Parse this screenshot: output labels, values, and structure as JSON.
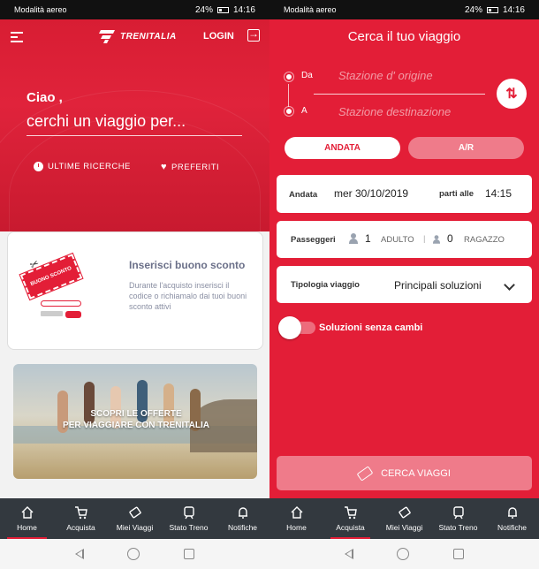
{
  "status_bar": {
    "carrier": "Modalità aereo",
    "battery": "24%",
    "time": "14:16"
  },
  "left": {
    "header": {
      "logo_text": "TRENITALIA",
      "login_label": "LOGIN"
    },
    "greeting": {
      "title": "Ciao ,",
      "subtitle": "cerchi un viaggio per..."
    },
    "quick_links": {
      "recent": "ULTIME RICERCHE",
      "favorites": "PREFERITI"
    },
    "coupon": {
      "ticket_text": "BUONO SCONTO",
      "title": "Inserisci buono sconto",
      "description": "Durante l'acquisto inserisci il codice o richiamalo dai tuoi buoni sconto attivi"
    },
    "promo": {
      "line1": "SCOPRI LE OFFERTE",
      "line2": "PER VIAGGIARE CON TRENITALIA"
    }
  },
  "right": {
    "title": "Cerca il tuo viaggio",
    "from_label": "Da",
    "from_placeholder": "Stazione d' origine",
    "to_label": "A",
    "to_placeholder": "Stazione destinazione",
    "trip_types": [
      "ANDATA",
      "A/R"
    ],
    "date": {
      "label": "Andata",
      "value": "mer 30/10/2019",
      "time_label": "parti alle",
      "time_value": "14:15"
    },
    "passengers": {
      "label": "Passeggeri",
      "adults_count": "1",
      "adults_label": "ADULTO",
      "kids_count": "0",
      "kids_label": "RAGAZZO"
    },
    "trip_kind": {
      "label": "Tipologia viaggio",
      "value": "Principali soluzioni"
    },
    "direct_toggle": {
      "label": "Soluzioni senza cambi",
      "on": false
    },
    "search_button": "CERCA VIAGGI"
  },
  "bottom_nav": [
    {
      "label": "Home",
      "icon": "home-icon"
    },
    {
      "label": "Acquista",
      "icon": "cart-icon"
    },
    {
      "label": "Miei Viaggi",
      "icon": "ticket-icon"
    },
    {
      "label": "Stato Treno",
      "icon": "train-icon"
    },
    {
      "label": "Notifiche",
      "icon": "bell-icon"
    }
  ],
  "colors": {
    "brand_red": "#e31e37",
    "nav_dark": "#33393f",
    "inactive_pink": "#ef7b8a"
  }
}
